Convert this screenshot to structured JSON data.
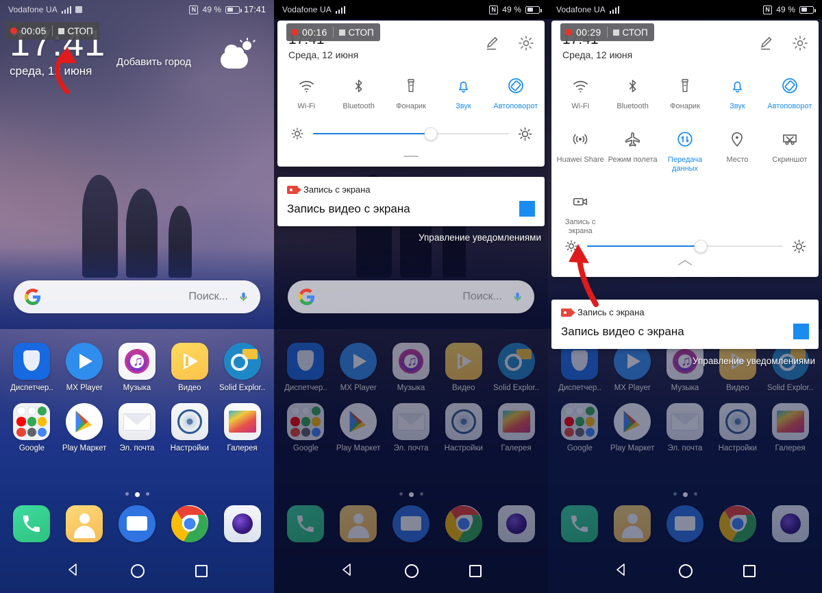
{
  "status_bar": {
    "carrier": "Vodafone UA",
    "battery_percent": "49 %",
    "time": "17:41",
    "nfc_icon": "nfc-icon",
    "signal_icon": "signal-bars-icon",
    "sim_icon": "sim-card-icon",
    "battery_icon": "battery-icon"
  },
  "panels": [
    {
      "id": "panel-home",
      "rec_badge": {
        "time": "00:05",
        "stop_label": "СТОП"
      },
      "widget": {
        "clock": "17:41",
        "date": "среда, 12 июня",
        "add_city": "Добавить город",
        "weather_icon": "partly-cloudy-icon"
      }
    },
    {
      "id": "panel-quick-settings-collapsed",
      "rec_badge": {
        "time": "00:16",
        "stop_label": "СТОП"
      }
    },
    {
      "id": "panel-quick-settings-expanded",
      "rec_badge": {
        "time": "00:29",
        "stop_label": "СТОП"
      }
    }
  ],
  "quick_settings": {
    "time": "17:41",
    "date": "Среда, 12 июня",
    "edit_icon": "pencil-edit-icon",
    "settings_icon": "gear-icon",
    "row1": [
      {
        "label": "Wi-Fi",
        "icon": "wifi-icon",
        "active": false
      },
      {
        "label": "Bluetooth",
        "icon": "bluetooth-icon",
        "active": false
      },
      {
        "label": "Фонарик",
        "icon": "flashlight-icon",
        "active": false
      },
      {
        "label": "Звук",
        "icon": "bell-icon",
        "active": true
      },
      {
        "label": "Автоповорот",
        "icon": "auto-rotate-icon",
        "active": true
      }
    ],
    "row2": [
      {
        "label": "Huawei Share",
        "icon": "huawei-share-icon",
        "active": false
      },
      {
        "label": "Режим полета",
        "icon": "airplane-icon",
        "active": false
      },
      {
        "label": "Передача данных",
        "icon": "data-transfer-icon",
        "active": true
      },
      {
        "label": "Место",
        "icon": "location-pin-icon",
        "active": false
      },
      {
        "label": "Скриншот",
        "icon": "screenshot-icon",
        "active": false
      }
    ],
    "row3": [
      {
        "label": "Запись с экрана",
        "icon": "screen-record-icon",
        "active": false
      }
    ],
    "brightness": {
      "value_percent": 60,
      "low_icon": "brightness-low-icon",
      "high_icon": "brightness-high-icon"
    },
    "handle_icon": "drag-handle-icon",
    "collapse_icon": "chevron-up-icon"
  },
  "notification": {
    "app_name": "Запись с экрана",
    "title": "Запись видео с экрана",
    "app_icon": "video-record-icon",
    "action_icon": "stop-square-button",
    "manage_label": "Управление уведомлениями"
  },
  "home": {
    "search": {
      "placeholder": "Поиск...",
      "google_icon": "google-g-icon",
      "mic_icon": "microphone-icon"
    },
    "apps_row1": [
      {
        "label": "Диспетчер..",
        "icon": "phone-manager-icon"
      },
      {
        "label": "MX Player",
        "icon": "mx-player-icon"
      },
      {
        "label": "Музыка",
        "icon": "music-icon"
      },
      {
        "label": "Видео",
        "icon": "video-icon"
      },
      {
        "label": "Solid Explor..",
        "icon": "solid-explorer-icon"
      }
    ],
    "apps_row2": [
      {
        "label": "Google",
        "icon": "google-folder-icon"
      },
      {
        "label": "Play Маркет",
        "icon": "play-store-icon"
      },
      {
        "label": "Эл. почта",
        "icon": "email-icon"
      },
      {
        "label": "Настройки",
        "icon": "settings-icon"
      },
      {
        "label": "Галерея",
        "icon": "gallery-icon"
      }
    ],
    "dock": [
      {
        "label": "Телефон",
        "icon": "phone-icon"
      },
      {
        "label": "Контакты",
        "icon": "contacts-icon"
      },
      {
        "label": "Сообщения",
        "icon": "messages-icon"
      },
      {
        "label": "Chrome",
        "icon": "chrome-icon"
      },
      {
        "label": "Камера",
        "icon": "camera-icon"
      }
    ],
    "page_dots": 3,
    "active_dot": 1
  },
  "nav_bar": {
    "back_icon": "back-triangle-icon",
    "home_icon": "home-circle-icon",
    "recents_icon": "recents-square-icon"
  }
}
